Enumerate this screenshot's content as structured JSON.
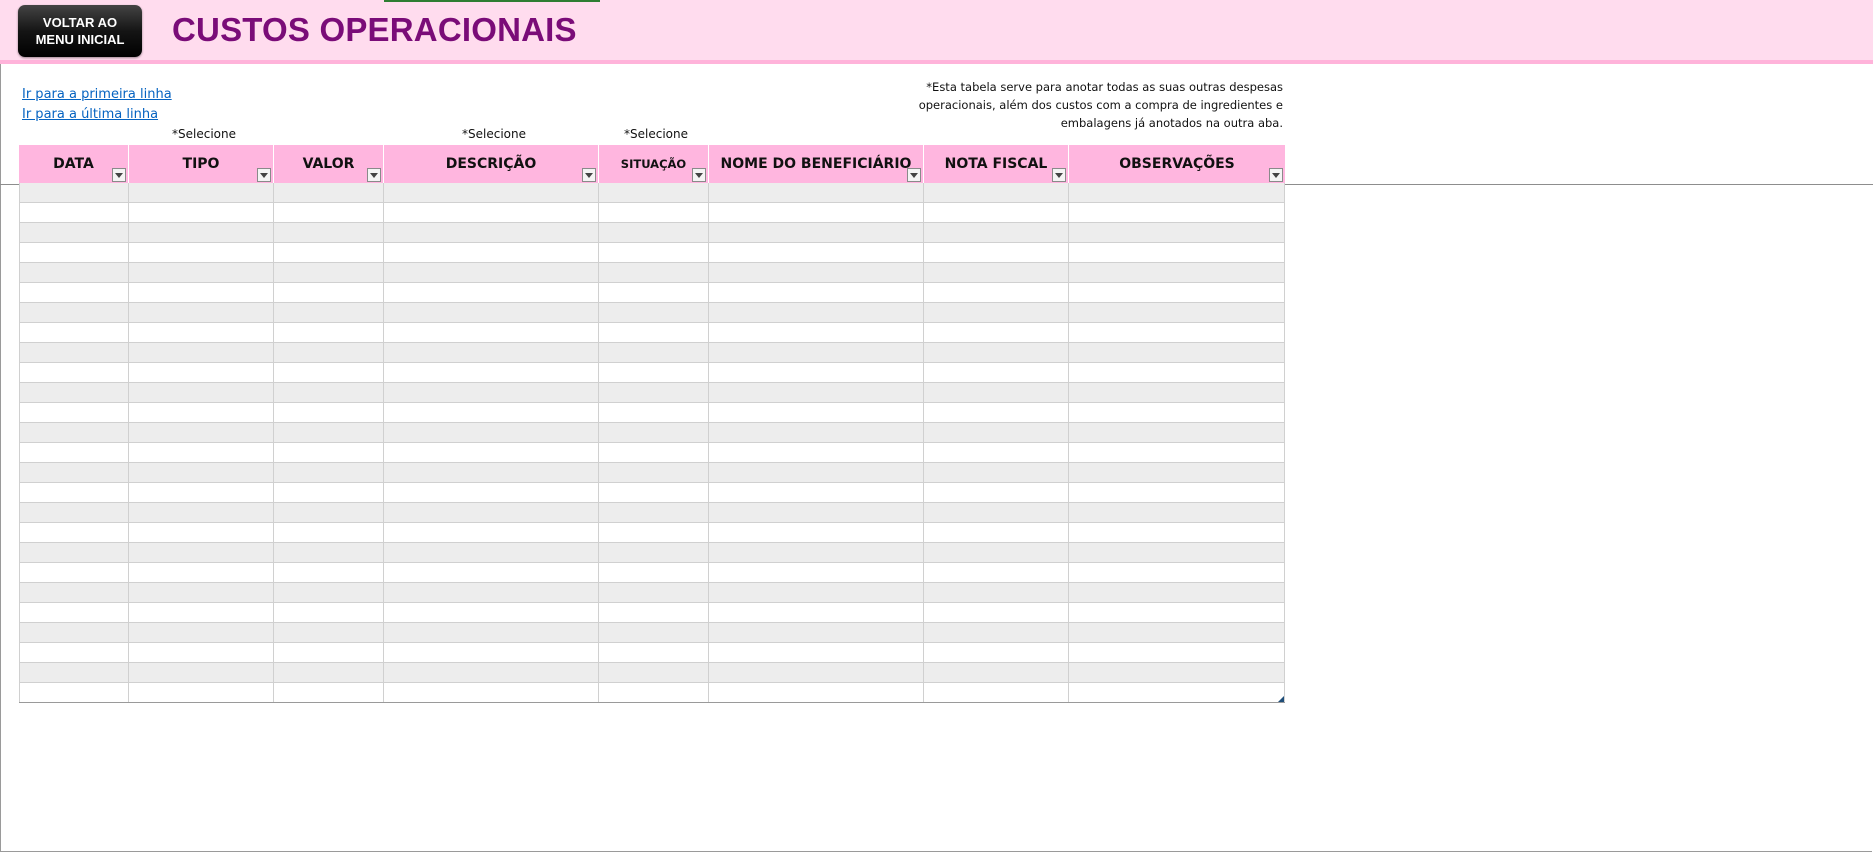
{
  "header": {
    "back_button": {
      "line1": "VOLTAR AO",
      "line2": "MENU INICIAL"
    },
    "title": "CUSTOS OPERACIONAIS"
  },
  "links": {
    "first_row": "Ir para a primeira linha",
    "last_row": "Ir para a última linha"
  },
  "note": {
    "line1": "*Esta tabela serve para anotar todas as suas outras despesas",
    "line2": "operacionais, além dos custos com a compra de ingredientes e",
    "line3": "embalagens já anotados na outra aba."
  },
  "select_hints": {
    "tipo": "*Selecione",
    "descricao": "*Selecione",
    "situacao": "*Selecione"
  },
  "table": {
    "columns": [
      {
        "key": "data",
        "label": "DATA"
      },
      {
        "key": "tipo",
        "label": "TIPO"
      },
      {
        "key": "valor",
        "label": "VALOR"
      },
      {
        "key": "descricao",
        "label": "DESCRIÇÃO"
      },
      {
        "key": "situacao",
        "label": "SITUAÇÃO"
      },
      {
        "key": "beneficiario",
        "label": "NOME DO BENEFICIÁRIO"
      },
      {
        "key": "nota_fiscal",
        "label": "NOTA FISCAL"
      },
      {
        "key": "observacoes",
        "label": "OBSERVAÇÕES"
      }
    ],
    "rows": [
      [
        "",
        "",
        "",
        "",
        "",
        "",
        "",
        ""
      ],
      [
        "",
        "",
        "",
        "",
        "",
        "",
        "",
        ""
      ],
      [
        "",
        "",
        "",
        "",
        "",
        "",
        "",
        ""
      ],
      [
        "",
        "",
        "",
        "",
        "",
        "",
        "",
        ""
      ],
      [
        "",
        "",
        "",
        "",
        "",
        "",
        "",
        ""
      ],
      [
        "",
        "",
        "",
        "",
        "",
        "",
        "",
        ""
      ],
      [
        "",
        "",
        "",
        "",
        "",
        "",
        "",
        ""
      ],
      [
        "",
        "",
        "",
        "",
        "",
        "",
        "",
        ""
      ],
      [
        "",
        "",
        "",
        "",
        "",
        "",
        "",
        ""
      ],
      [
        "",
        "",
        "",
        "",
        "",
        "",
        "",
        ""
      ],
      [
        "",
        "",
        "",
        "",
        "",
        "",
        "",
        ""
      ],
      [
        "",
        "",
        "",
        "",
        "",
        "",
        "",
        ""
      ],
      [
        "",
        "",
        "",
        "",
        "",
        "",
        "",
        ""
      ],
      [
        "",
        "",
        "",
        "",
        "",
        "",
        "",
        ""
      ],
      [
        "",
        "",
        "",
        "",
        "",
        "",
        "",
        ""
      ],
      [
        "",
        "",
        "",
        "",
        "",
        "",
        "",
        ""
      ],
      [
        "",
        "",
        "",
        "",
        "",
        "",
        "",
        ""
      ],
      [
        "",
        "",
        "",
        "",
        "",
        "",
        "",
        ""
      ],
      [
        "",
        "",
        "",
        "",
        "",
        "",
        "",
        ""
      ],
      [
        "",
        "",
        "",
        "",
        "",
        "",
        "",
        ""
      ],
      [
        "",
        "",
        "",
        "",
        "",
        "",
        "",
        ""
      ],
      [
        "",
        "",
        "",
        "",
        "",
        "",
        "",
        ""
      ],
      [
        "",
        "",
        "",
        "",
        "",
        "",
        "",
        ""
      ],
      [
        "",
        "",
        "",
        "",
        "",
        "",
        "",
        ""
      ],
      [
        "",
        "",
        "",
        "",
        "",
        "",
        "",
        ""
      ],
      [
        "",
        "",
        "",
        "",
        "",
        "",
        "",
        ""
      ]
    ]
  },
  "colors": {
    "header_band": "#ffdcee",
    "header_accent": "#ffb3da",
    "title": "#7a0c78",
    "table_header": "#ffb6df",
    "row_shaded": "#ededed",
    "link": "#0563c1"
  },
  "icons": {
    "filter": "filter-dropdown-icon",
    "resize": "table-resize-handle-icon"
  }
}
